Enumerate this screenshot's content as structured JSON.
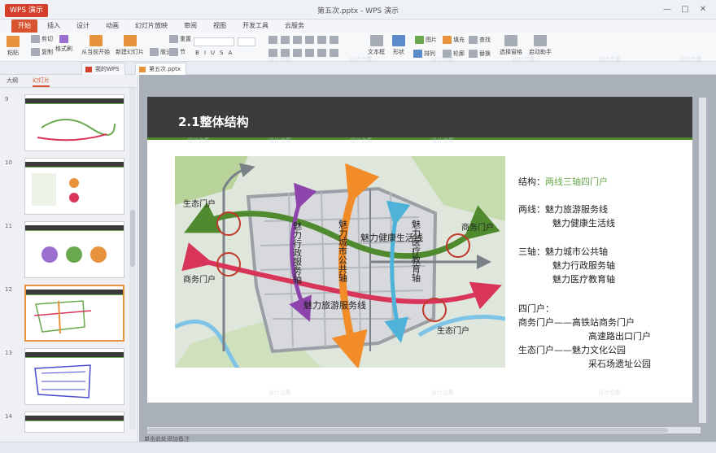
{
  "app": {
    "menu_button": "WPS 演示",
    "window_title": "第五次.pptx - WPS 演示",
    "window_controls": [
      "—",
      "□",
      "✕"
    ]
  },
  "ribbon_tabs": [
    "开始",
    "插入",
    "设计",
    "动画",
    "幻灯片放映",
    "审阅",
    "视图",
    "开发工具",
    "云服务"
  ],
  "ribbon": {
    "paste": "粘贴",
    "cut": "剪切",
    "copy": "复制",
    "format_painter": "格式刷",
    "from_current": "从当前开始",
    "new_slide": "新建幻灯片",
    "layout": "版式",
    "reset": "重置",
    "section": "节",
    "textbox": "文本框",
    "shape": "形状",
    "arrange": "排列",
    "picture": "图片",
    "fill": "填充",
    "outline": "轮廓",
    "find": "查找",
    "replace": "替换",
    "select_pane": "选择窗格",
    "assistant": "启动助手"
  },
  "doc_tabs": [
    "我的WPS",
    "第五次.pptx"
  ],
  "left_pane": {
    "tab_outline": "大纲",
    "tab_slides": "幻灯片",
    "slide_numbers": [
      "9",
      "10",
      "11",
      "12",
      "13",
      "14"
    ]
  },
  "slide": {
    "title": "2.1整体结构",
    "map_labels": {
      "eco_gate_left": "生态门户",
      "business_gate_left": "商务门户",
      "business_gate_right": "商务门户",
      "eco_gate_bottom": "生态门户",
      "tourism_service_line": "魅力旅游服务线",
      "health_life_line": "魅力健康生活线",
      "admin_axis": "魅力行政服务轴",
      "public_axis": "魅力城市公共轴",
      "medical_axis": "魅力医疗教育轴"
    },
    "structure_label": "结构：",
    "structure_value": "两线三轴四门户",
    "two_lines_label": "两线：",
    "two_lines": [
      "魅力旅游服务线",
      "魅力健康生活线"
    ],
    "three_axes_label": "三轴：",
    "three_axes": [
      "魅力城市公共轴",
      "魅力行政服务轴",
      "魅力医疗教育轴"
    ],
    "four_gates_label": "四门户：",
    "gates_line1": "商务门户——高铁站商务门户",
    "gates_line2": "高速路出口门户",
    "gates_line3": "生态门户——魅力文化公园",
    "gates_line4": "采石场遗址公园"
  },
  "notes_placeholder": "单击此处添加备注",
  "watermark": "设计合集",
  "colors": {
    "accent": "#d8532f",
    "slide_header": "#3c3c3c",
    "slide_rule": "#4f8a2e",
    "green_line": "#4f8a2e",
    "orange_axis": "#f28c28",
    "purple_axis": "#8e44ad",
    "blue_axis": "#4fb3d9",
    "red_line": "#d9345a"
  }
}
